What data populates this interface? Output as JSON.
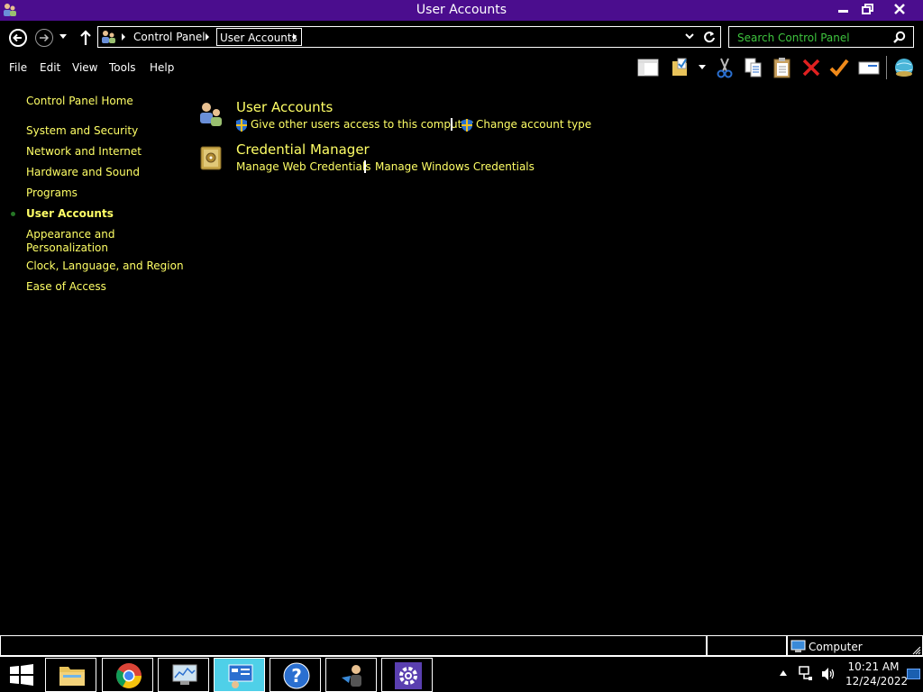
{
  "window": {
    "title": "User Accounts"
  },
  "address": {
    "crumbs": [
      "Control Panel",
      "User Accounts"
    ],
    "search_placeholder": "Search Control Panel"
  },
  "menu": [
    "File",
    "Edit",
    "View",
    "Tools",
    "Help"
  ],
  "toolbar_icons": [
    "layout-pane-icon",
    "properties-icon",
    "cut-icon",
    "copy-icon",
    "paste-icon",
    "delete-icon",
    "undo-check-icon",
    "email-icon",
    "globe-icon"
  ],
  "sidebar": {
    "home": "Control Panel Home",
    "items": [
      "System and Security",
      "Network and Internet",
      "Hardware and Sound",
      "Programs",
      "User Accounts",
      "Appearance and Personalization",
      "Clock, Language, and Region",
      "Ease of Access"
    ],
    "current": "User Accounts"
  },
  "categories": [
    {
      "title": "User Accounts",
      "links": [
        "Give other users access to this computer",
        "Change account type"
      ]
    },
    {
      "title": "Credential Manager",
      "links": [
        "Manage Web Credentials",
        "Manage Windows Credentials"
      ]
    }
  ],
  "statusbar": {
    "location": "Computer"
  },
  "taskbar": {
    "apps": [
      "file-explorer",
      "chrome",
      "performance-monitor",
      "control-panel",
      "help",
      "user-accounts",
      "settings"
    ],
    "time": "10:21 AM",
    "date": "12/24/2022"
  },
  "colors": {
    "titlebar": "#4b0d8e",
    "link": "#ffff66",
    "search_placeholder": "#3ec43e",
    "active_task": "#4fd0e8"
  }
}
